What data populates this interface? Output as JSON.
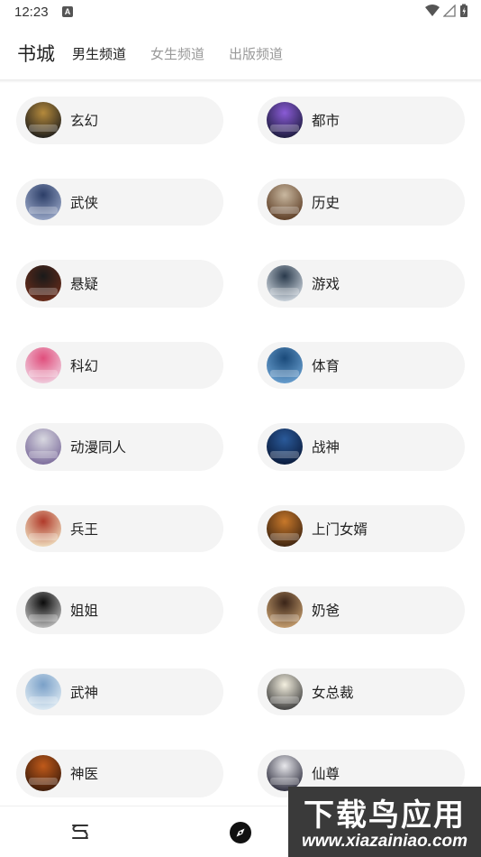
{
  "status": {
    "time": "12:23",
    "notification_letter": "A"
  },
  "header": {
    "brand": "书城",
    "tabs": [
      {
        "label": "男生频道",
        "active": true
      },
      {
        "label": "女生频道",
        "active": false
      },
      {
        "label": "出版频道",
        "active": false
      }
    ]
  },
  "categories": [
    {
      "label": "玄幻",
      "colors": [
        "#b58a3c",
        "#1c1c1c"
      ]
    },
    {
      "label": "都市",
      "colors": [
        "#8a5bd6",
        "#1a1a3a"
      ]
    },
    {
      "label": "武侠",
      "colors": [
        "#2c3e68",
        "#9aa8c8"
      ]
    },
    {
      "label": "历史",
      "colors": [
        "#c9b8a0",
        "#5a3a22"
      ]
    },
    {
      "label": "悬疑",
      "colors": [
        "#1a1a1a",
        "#6b2c1a"
      ]
    },
    {
      "label": "游戏",
      "colors": [
        "#2a3a4c",
        "#d0d8e0"
      ]
    },
    {
      "label": "科幻",
      "colors": [
        "#e04e7c",
        "#f0d0e0"
      ]
    },
    {
      "label": "体育",
      "colors": [
        "#1a4a7a",
        "#6aa0d0"
      ]
    },
    {
      "label": "动漫同人",
      "colors": [
        "#d8d8e0",
        "#7a6a9a"
      ]
    },
    {
      "label": "战神",
      "colors": [
        "#2a5a9a",
        "#0a1a3a"
      ]
    },
    {
      "label": "兵王",
      "colors": [
        "#b03a2a",
        "#f0e0c0"
      ]
    },
    {
      "label": "上门女婿",
      "colors": [
        "#c8782a",
        "#3a2210"
      ]
    },
    {
      "label": "姐姐",
      "colors": [
        "#0a0a0a",
        "#c0c0c0"
      ]
    },
    {
      "label": "奶爸",
      "colors": [
        "#3a2418",
        "#c8a070"
      ]
    },
    {
      "label": "武神",
      "colors": [
        "#7aa0c8",
        "#e0ecf4"
      ]
    },
    {
      "label": "女总裁",
      "colors": [
        "#f4f0e0",
        "#3a3a3a"
      ]
    },
    {
      "label": "神医",
      "colors": [
        "#c05a1a",
        "#3a1a0a"
      ]
    },
    {
      "label": "仙尊",
      "colors": [
        "#e8e8ec",
        "#2a2a3a"
      ]
    }
  ],
  "bottom_nav": {
    "items": [
      {
        "icon": "bookshelf-icon"
      },
      {
        "icon": "compass-icon"
      }
    ]
  },
  "watermark": {
    "title": "下载鸟应用",
    "url": "www.xiazainiao.com"
  }
}
